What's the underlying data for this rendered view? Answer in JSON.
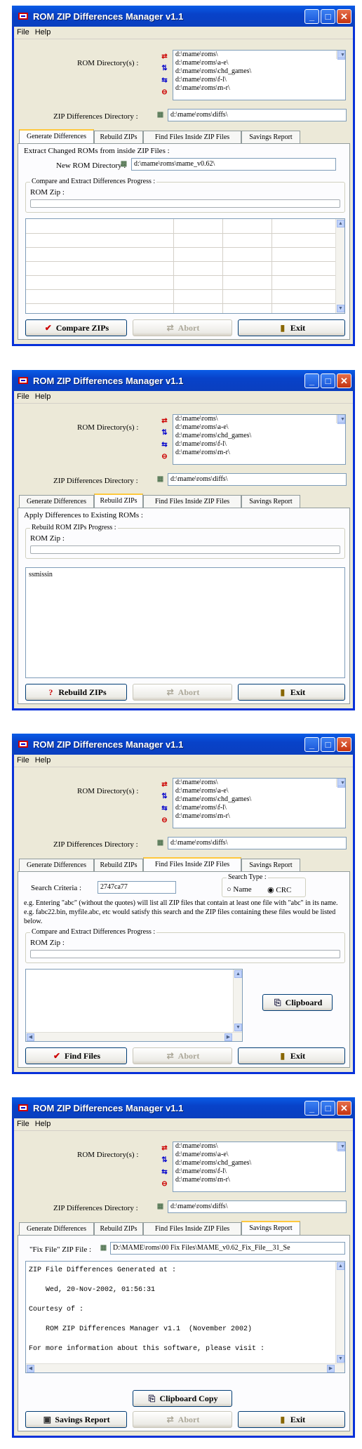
{
  "app": {
    "title": "ROM ZIP Differences Manager v1.1"
  },
  "menu": [
    "File",
    "Help"
  ],
  "common": {
    "rom_dir_label": "ROM Directory(s) :",
    "rom_dirs": [
      "d:\\mame\\roms\\",
      "d:\\mame\\roms\\a-e\\",
      "d:\\mame\\roms\\chd_games\\",
      "d:\\mame\\roms\\f-l\\",
      "d:\\mame\\roms\\m-r\\"
    ],
    "zipdiff_label": "ZIP Differences Directory :",
    "zipdiff_value": "d:\\mame\\roms\\diffs\\"
  },
  "tabs": [
    "Generate Differences",
    "Rebuild ZIPs",
    "Find Files Inside ZIP Files",
    "Savings Report"
  ],
  "abort": "Abort",
  "exit": "Exit",
  "s1": {
    "group_title": "Extract Changed ROMs from inside ZIP Files :",
    "new_rom_label": "New ROM Directory :",
    "new_rom_value": "d:\\mame\\roms\\mame_v0.62\\",
    "progress_group": "Compare and Extract Differences Progress :",
    "rom_zip_label": "ROM Zip :",
    "primary_button": "Compare ZIPs"
  },
  "s2": {
    "group_title": "Apply Differences to Existing ROMs :",
    "progress_group": "Rebuild ROM ZIPs Progress :",
    "rom_zip_label": "ROM Zip :",
    "log_item": "ssmissin",
    "primary_button": "Rebuild ZIPs"
  },
  "s3": {
    "search_label": "Search Criteria :",
    "search_value": "2747ca77",
    "search_type_label": "Search Type :",
    "radio_name": "Name",
    "radio_crc": "CRC",
    "help_text": "e.g.  Entering \"abc\" (without the quotes) will list all ZIP files that contain at least one file with \"abc\" in its name.  e.g.  fabc22.bin, myfile.abc, etc would satisfy this search and the ZIP files containing these files would be listed below.",
    "progress_group": "Compare and Extract Differences Progress :",
    "rom_zip_label": "ROM Zip :",
    "clipboard_button": "Clipboard",
    "primary_button": "Find Files"
  },
  "s4": {
    "fixfile_label": "\"Fix File\" ZIP File :",
    "fixfile_value": "D:\\MAME\\roms\\00 Fix Files\\MAME_v0.62_Fix_File__31_Se",
    "report_lines": [
      "ZIP File Differences Generated at :",
      "",
      "    Wed, 20-Nov-2002, 01:56:31",
      "",
      "Courtesy of :",
      "",
      "    ROM ZIP Differences Manager v1.1  (November 2002)",
      "",
      "For more information about this software, please visit :"
    ],
    "clipboard_copy_button": "Clipboard Copy",
    "primary_button": "Savings Report"
  }
}
